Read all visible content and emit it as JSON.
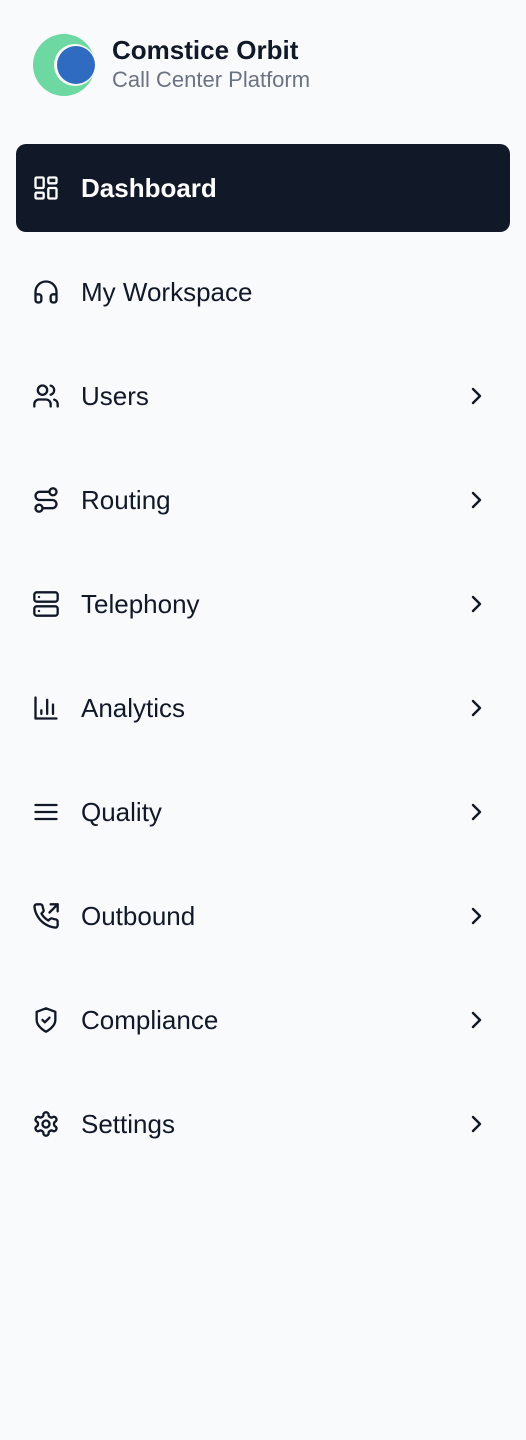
{
  "brand": {
    "name": "Comstice Orbit",
    "subtitle": "Call Center Platform"
  },
  "colors": {
    "active_bg": "#111827",
    "text": "#111827",
    "muted": "#6b7280",
    "logo_green": "#6ed8a2",
    "logo_blue": "#2f6bc0",
    "background": "#f9fafb"
  },
  "nav": {
    "items": [
      {
        "label": "Dashboard",
        "icon": "layout-dashboard-icon",
        "active": true,
        "has_submenu": false
      },
      {
        "label": "My Workspace",
        "icon": "headphones-icon",
        "active": false,
        "has_submenu": false
      },
      {
        "label": "Users",
        "icon": "users-icon",
        "active": false,
        "has_submenu": true
      },
      {
        "label": "Routing",
        "icon": "route-icon",
        "active": false,
        "has_submenu": true
      },
      {
        "label": "Telephony",
        "icon": "server-icon",
        "active": false,
        "has_submenu": true
      },
      {
        "label": "Analytics",
        "icon": "bar-chart-icon",
        "active": false,
        "has_submenu": true
      },
      {
        "label": "Quality",
        "icon": "menu-lines-icon",
        "active": false,
        "has_submenu": true
      },
      {
        "label": "Outbound",
        "icon": "phone-outgoing-icon",
        "active": false,
        "has_submenu": true
      },
      {
        "label": "Compliance",
        "icon": "shield-check-icon",
        "active": false,
        "has_submenu": true
      },
      {
        "label": "Settings",
        "icon": "gear-icon",
        "active": false,
        "has_submenu": true
      }
    ]
  }
}
